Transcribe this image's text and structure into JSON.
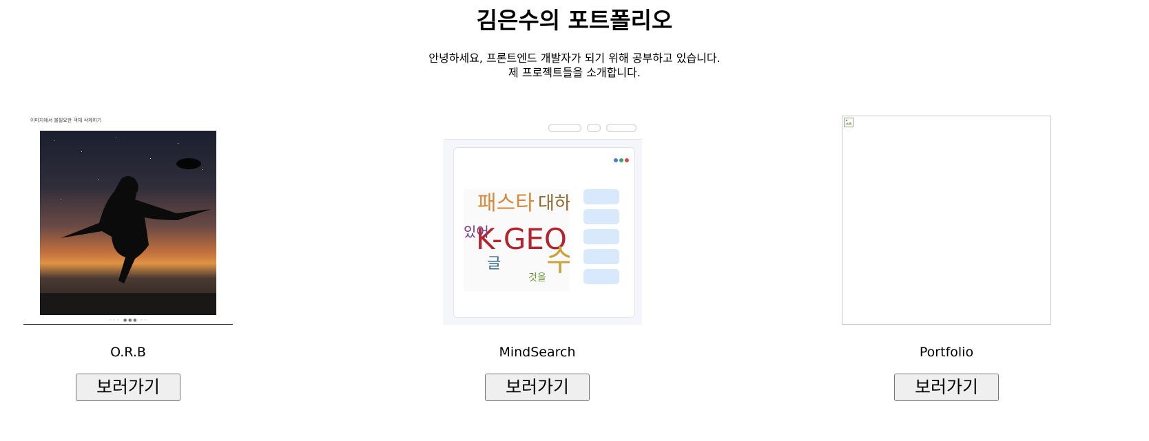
{
  "header": {
    "title": "김은수의 포트폴리오",
    "intro_line1": "안녕하세요, 프론트엔드 개발자가 되기 위해 공부하고 있습니다.",
    "intro_line2": "제 프로젝트들을 소개합니다."
  },
  "projects": [
    {
      "name": "O.R.B",
      "button_label": "보러가기",
      "thumb_caption": "이미지에서 불필요한 객체 삭제하기"
    },
    {
      "name": "MindSearch",
      "button_label": "보러가기",
      "thumb_words": [
        "패스타",
        "대하",
        "K-GEO",
        "있어",
        "수",
        "글",
        "것을"
      ]
    },
    {
      "name": "Portfolio",
      "button_label": "보러가기",
      "thumb_state": "broken-image-icon"
    }
  ],
  "colors": {
    "button_bg": "#efefef",
    "button_border": "#767676",
    "chip_bg": "#d8e9fb"
  }
}
